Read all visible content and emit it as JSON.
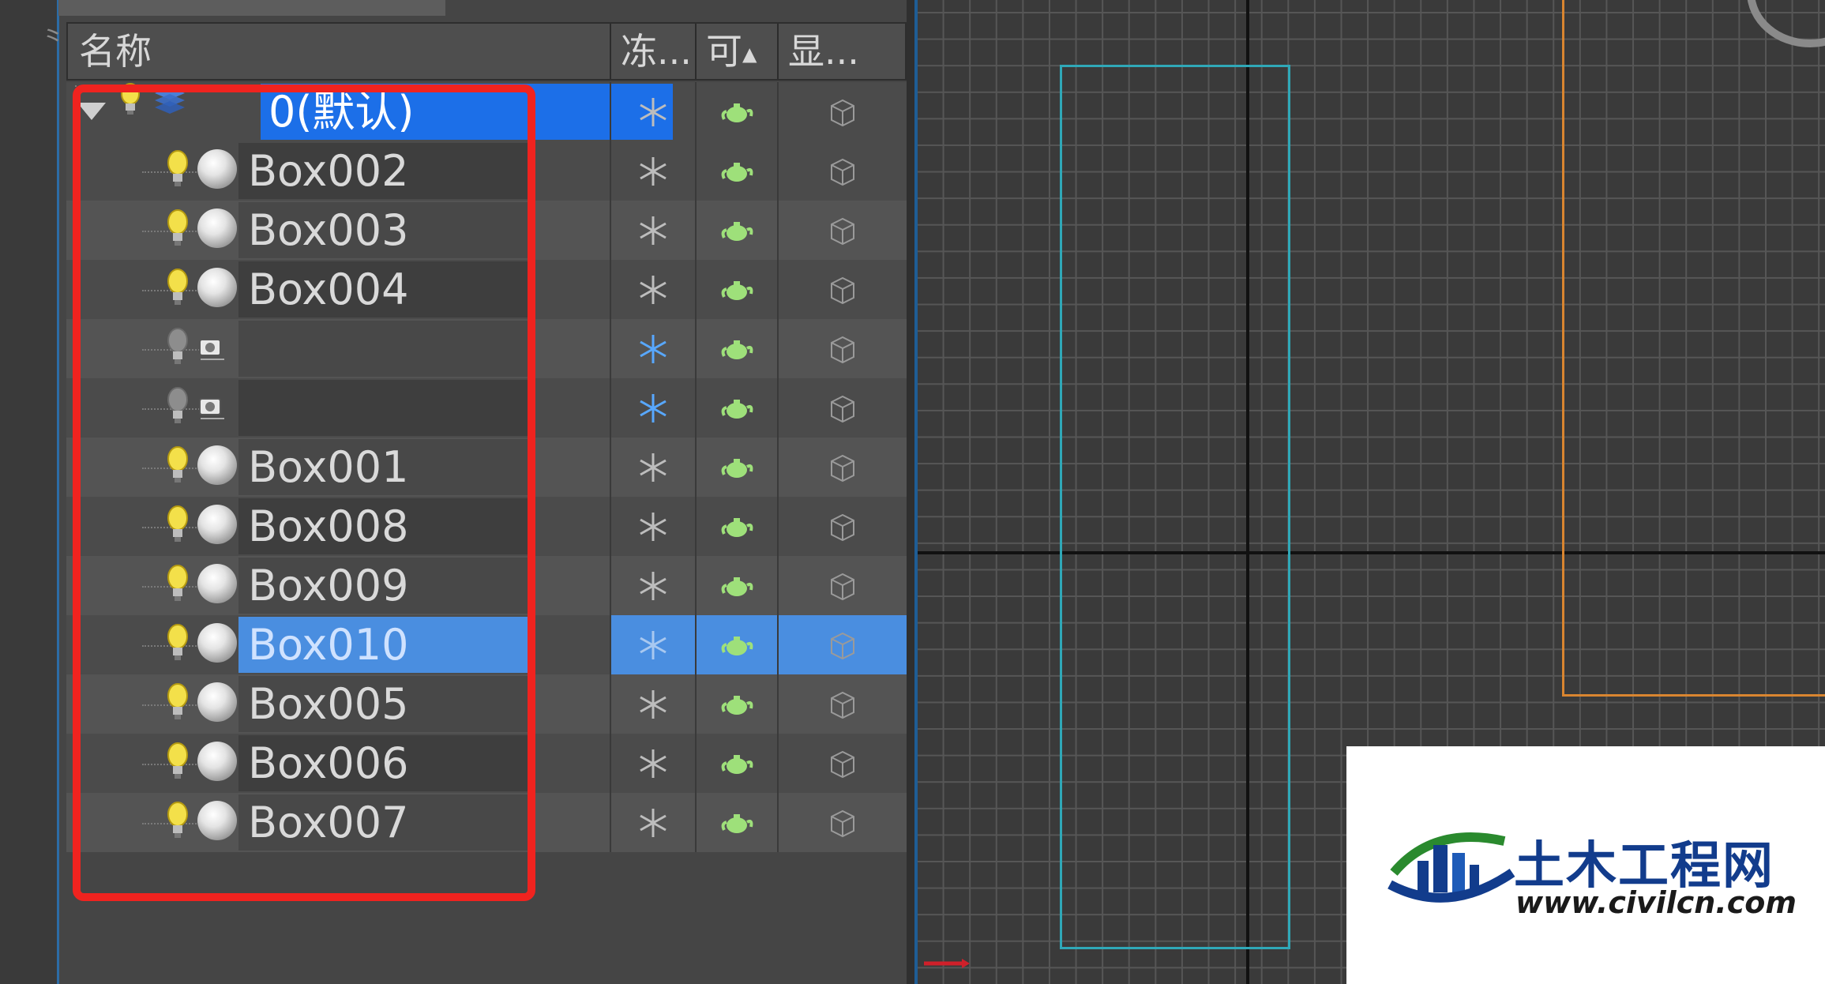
{
  "scene_explorer": {
    "columns": {
      "name": "名称",
      "frozen": "冻...",
      "renderable": "可",
      "display": "显..."
    },
    "layer": {
      "label": "0(默认)"
    },
    "rows": [
      {
        "label": "Box002",
        "type": "object"
      },
      {
        "label": "Box003",
        "type": "object"
      },
      {
        "label": "Box004",
        "type": "object"
      },
      {
        "label": "",
        "type": "camera"
      },
      {
        "label": "",
        "type": "camera"
      },
      {
        "label": "Box001",
        "type": "object"
      },
      {
        "label": "Box008",
        "type": "object"
      },
      {
        "label": "Box009",
        "type": "object"
      },
      {
        "label": "Box010",
        "type": "object",
        "selected": true
      },
      {
        "label": "Box005",
        "type": "object"
      },
      {
        "label": "Box006",
        "type": "object"
      },
      {
        "label": "Box007",
        "type": "object"
      }
    ],
    "icons": {
      "visibility": "lightbulb-icon",
      "object": "sphere-icon",
      "camera": "camera-icon",
      "frozen": "snowflake-icon",
      "renderable": "teapot-icon",
      "display": "box-wireframe-icon",
      "layer": "layer-stack-icon"
    },
    "colors": {
      "selection": "#4a8ee0",
      "layer_highlight": "#1c6fe8",
      "annotation_box": "#f0231f"
    }
  },
  "watermark": {
    "title": "土木工程网",
    "url": "www.civilcn.com"
  }
}
